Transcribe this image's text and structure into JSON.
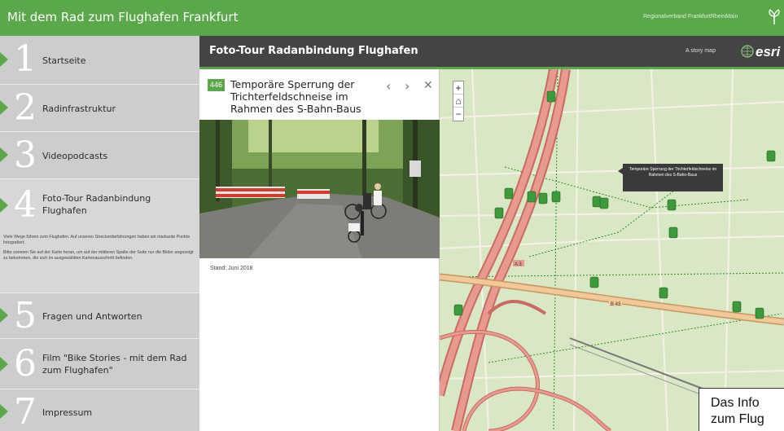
{
  "header": {
    "title": "Mit dem Rad zum Flughafen Frankfurt",
    "subtitle": "Regionalverband FrankfurtRheinMain",
    "logo_icon": "ivy-leaf-icon"
  },
  "nav": {
    "items": [
      {
        "number": "1",
        "label": "Startseite"
      },
      {
        "number": "2",
        "label": "Radinfrastruktur"
      },
      {
        "number": "3",
        "label": "Videopodcasts"
      },
      {
        "number": "4",
        "label_line1": "Foto-Tour Radanbindung",
        "label_line2": "Flughafen"
      },
      {
        "number": "5",
        "label": "Fragen und Antworten"
      },
      {
        "number": "6",
        "label_line1": "Film \"Bike Stories - mit dem Rad",
        "label_line2": "zum Flughafen\""
      },
      {
        "number": "7",
        "label": "Impressum"
      }
    ],
    "desc1": "Viele Wege führen zum Flughafen. Auf unseren Streckenbefahrungen haben wir markante Punkte fotografiert.",
    "desc2": "Bitte zoomen Sie auf der Karte heran, um auf der mittleren Spalte der Seite nur die Bilder angezeigt zu bekommen, die sich im ausgewählten Kartenausschnitt befinden."
  },
  "story": {
    "title": "Foto-Tour Radanbindung Flughafen",
    "storymap_label": "A story map",
    "esri_label": "esri"
  },
  "panel": {
    "badge": "446",
    "title": "Temporäre Sperrung der Trichterfeldschneise im Rahmen des S-Bahn-Baus",
    "prev": "‹",
    "next": "›",
    "close": "✕",
    "caption": "Stand: Juni 2018"
  },
  "map": {
    "zoom_in": "+",
    "home": "⌂",
    "zoom_out": "−",
    "tooltip": "Temporäre Sperrung der Trichterfeldschneise im Rahmen des S-Bahn-Baus",
    "road_label_a3": "A 3",
    "road_label_b43": "B 43"
  },
  "infobox": {
    "text_line1": "Das Info",
    "text_line2": "zum Flug"
  },
  "colors": {
    "brand_green": "#5aa84a",
    "nav_gray": "#cdcdcd",
    "story_bar": "#444444"
  }
}
